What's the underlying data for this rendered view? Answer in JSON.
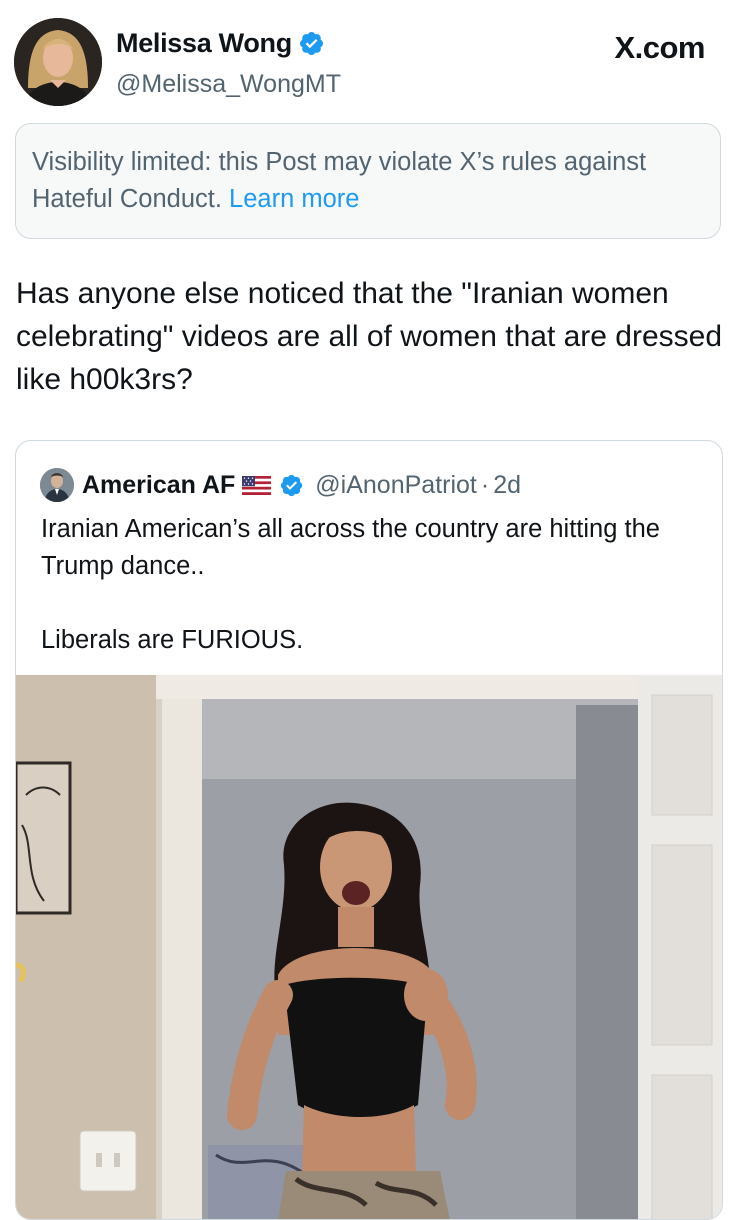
{
  "site": {
    "brand": "X.com"
  },
  "author": {
    "name": "Melissa Wong",
    "handle": "@Melissa_WongMT",
    "verified": true,
    "avatar_icon": "profile-photo"
  },
  "notice": {
    "text": "Visibility limited: this Post may violate X’s rules against Hateful Conduct.",
    "link": "Learn more"
  },
  "post": {
    "text": "Has anyone else noticed that the \"Iranian women celebrating\" videos are all of women that are dressed like h00k3rs?"
  },
  "quoted_post": {
    "name": "American AF",
    "flag_icon": "us-flag-icon",
    "verified": true,
    "handle": "@iAnonPatriot",
    "separator": "·",
    "time": "2d",
    "text": "Iranian American’s all across the country are hitting the Trump dance..\n\nLiberals are FURIOUS.",
    "media_icon": "dancing-woman-video-still"
  },
  "colors": {
    "text": "#0f1419",
    "secondary": "#536471",
    "link": "#1d9bf0",
    "verified_badge": "#1d9bf0",
    "notice_bg": "#f7f9f9",
    "border": "#cfd9de"
  }
}
